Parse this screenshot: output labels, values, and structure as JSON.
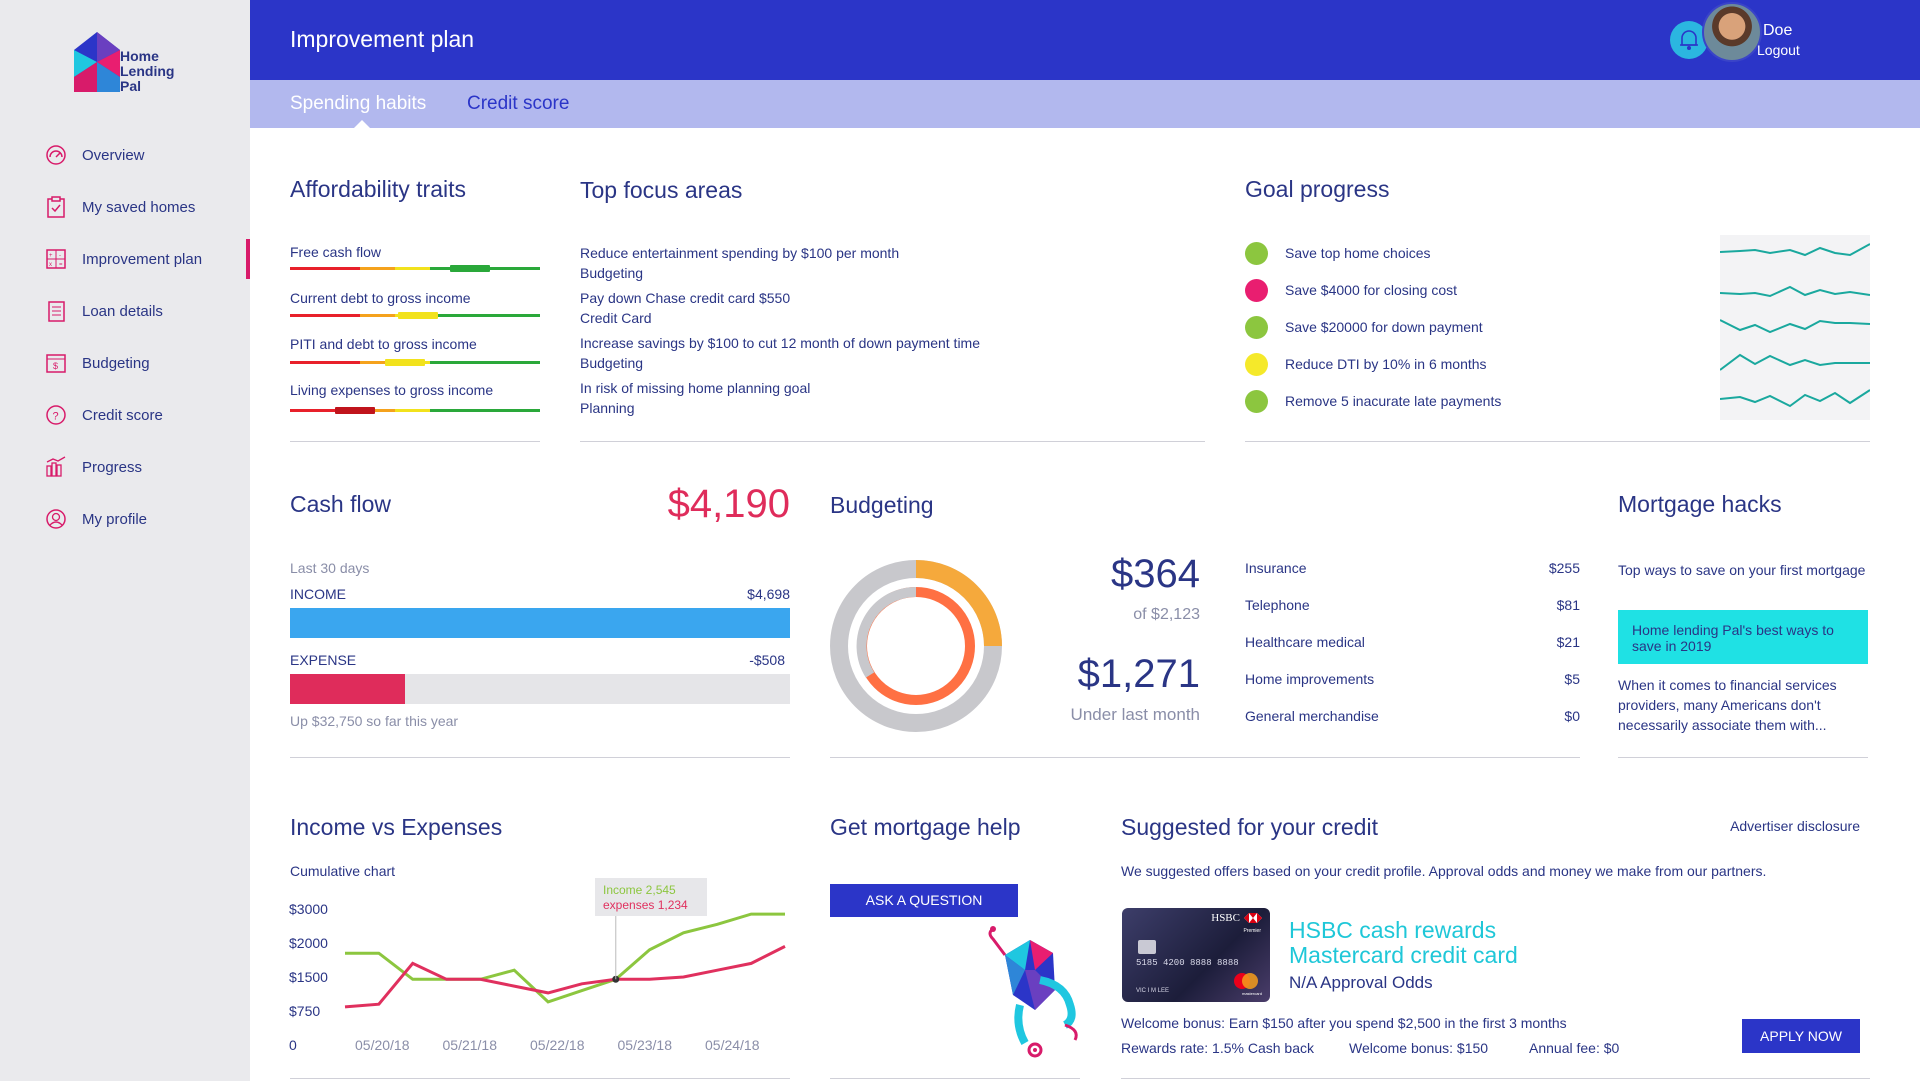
{
  "logo": {
    "text_line1": "Home",
    "text_line2": "Lending",
    "text_line3": "Pal"
  },
  "sidebar": {
    "items": [
      {
        "label": "Overview",
        "icon": "gauge-icon"
      },
      {
        "label": "My saved homes",
        "icon": "clipboard-check-icon"
      },
      {
        "label": "Improvement plan",
        "icon": "calculator-icon"
      },
      {
        "label": "Loan details",
        "icon": "document-icon"
      },
      {
        "label": "Budgeting",
        "icon": "budget-icon"
      },
      {
        "label": "Credit score",
        "icon": "question-circle-icon"
      },
      {
        "label": "Progress",
        "icon": "bar-chart-icon"
      },
      {
        "label": "My profile",
        "icon": "user-circle-icon"
      }
    ],
    "active_index": 2
  },
  "header": {
    "title": "Improvement plan",
    "user_name": "Doe",
    "logout": "Logout"
  },
  "tabs": [
    {
      "label": "Spending habits",
      "active": true
    },
    {
      "label": "Credit score",
      "active": false
    }
  ],
  "affordability": {
    "title": "Affordability traits",
    "traits": [
      {
        "label": "Free cash flow",
        "level": 0.71,
        "color": "#2aa83a"
      },
      {
        "label": "Current debt to gross income",
        "level": 0.5,
        "color": "#f2e21c"
      },
      {
        "label": "PITI and debt to gross income",
        "level": 0.45,
        "color": "#f2e21c"
      },
      {
        "label": "Living expenses to gross income",
        "level": 0.25,
        "color": "#c0141c"
      }
    ]
  },
  "focus": {
    "title": "Top focus areas",
    "items": [
      {
        "title": "Reduce entertainment spending by $100 per month",
        "category": "Budgeting"
      },
      {
        "title": "Pay down Chase credit card $550",
        "category": "Credit Card"
      },
      {
        "title": "Increase savings by $100 to cut 12 month of down payment time",
        "category": "Budgeting"
      },
      {
        "title": "In risk of missing home planning goal",
        "category": "Planning"
      }
    ]
  },
  "goals": {
    "title": "Goal progress",
    "items": [
      {
        "label": "Save top home choices",
        "color": "#8cc63f"
      },
      {
        "label": "Save $4000 for closing cost",
        "color": "#e91e70"
      },
      {
        "label": "Save $20000 for down payment",
        "color": "#8cc63f"
      },
      {
        "label": "Reduce DTI by 10% in 6 months",
        "color": "#f5e92a"
      },
      {
        "label": "Remove 5 inacurate late payments",
        "color": "#8cc63f"
      }
    ]
  },
  "cashflow": {
    "title": "Cash flow",
    "amount": "$4,190",
    "period": "Last 30 days",
    "income_label": "INCOME",
    "income_value": "$4,698",
    "expense_label": "EXPENSE",
    "expense_value": "-$508",
    "expense_ratio": 0.23,
    "footer": "Up $32,750 so far this year",
    "colors": {
      "income": "#3aa6ef",
      "expense": "#df2c5b"
    }
  },
  "budgeting": {
    "title": "Budgeting",
    "spent": "$364",
    "of_total": "of $2,123",
    "under": "$1,271",
    "under_label": "Under last month",
    "categories": [
      {
        "name": "Insurance",
        "amount": "$255"
      },
      {
        "name": "Telephone",
        "amount": "$81"
      },
      {
        "name": "Healthcare medical",
        "amount": "$21"
      },
      {
        "name": "Home improvements",
        "amount": "$5"
      },
      {
        "name": "General merchandise",
        "amount": "$0"
      }
    ]
  },
  "hacks": {
    "title": "Mortgage hacks",
    "intro": "Top ways to save on your first mortgage",
    "highlight": "Home lending Pal's best ways to save in 2019",
    "body": "When it comes to financial services providers, many Americans don't necessarily associate them with..."
  },
  "chart_data": {
    "type": "line",
    "title": "Income vs Expenses",
    "subtitle": "Cumulative chart",
    "x": [
      "05/20/18",
      "05/21/18",
      "05/22/18",
      "05/23/18",
      "05/24/18"
    ],
    "y_ticks": [
      "0",
      "$750",
      "$1500",
      "$2000",
      "$3000"
    ],
    "series": [
      {
        "name": "Income",
        "color": "#8cc63f",
        "values": [
          1850,
          1850,
          1450,
          1450,
          1450,
          1600,
          950,
          1200,
          1450,
          1900,
          2300,
          2550,
          2850,
          2850
        ]
      },
      {
        "name": "expenses",
        "color": "#e0305e",
        "values": [
          840,
          900,
          1700,
          1450,
          1450,
          1300,
          1150,
          1350,
          1450,
          1450,
          1500,
          1600,
          1700,
          1950
        ]
      }
    ],
    "tooltip": {
      "income": "Income 2,545",
      "expenses": "expenses 1,234"
    }
  },
  "mortgage_help": {
    "title": "Get mortgage help",
    "button": "ASK A QUESTION"
  },
  "credit": {
    "title": "Suggested for your credit",
    "disclosure": "Advertiser disclosure",
    "intro": "We suggested offers based on your credit profile. Approval odds and money we make from our partners.",
    "card_name_line1": "HSBC cash rewards",
    "card_name_line2": "Mastercard credit card",
    "approval": "N/A Approval Odds",
    "bonus": "Welcome bonus: Earn $150 after you spend $2,500 in the first 3 months",
    "rewards_rate": "Rewards rate: 1.5% Cash back",
    "welcome_bonus": "Welcome bonus: $150",
    "annual_fee": "Annual fee: $0",
    "apply": "APPLY NOW",
    "card_brand": "HSBC",
    "card_number": "5185 4200 8888 8888",
    "card_holder": "VIC I M LEE",
    "card_tier": "Premier",
    "card_network": "mastercard"
  }
}
